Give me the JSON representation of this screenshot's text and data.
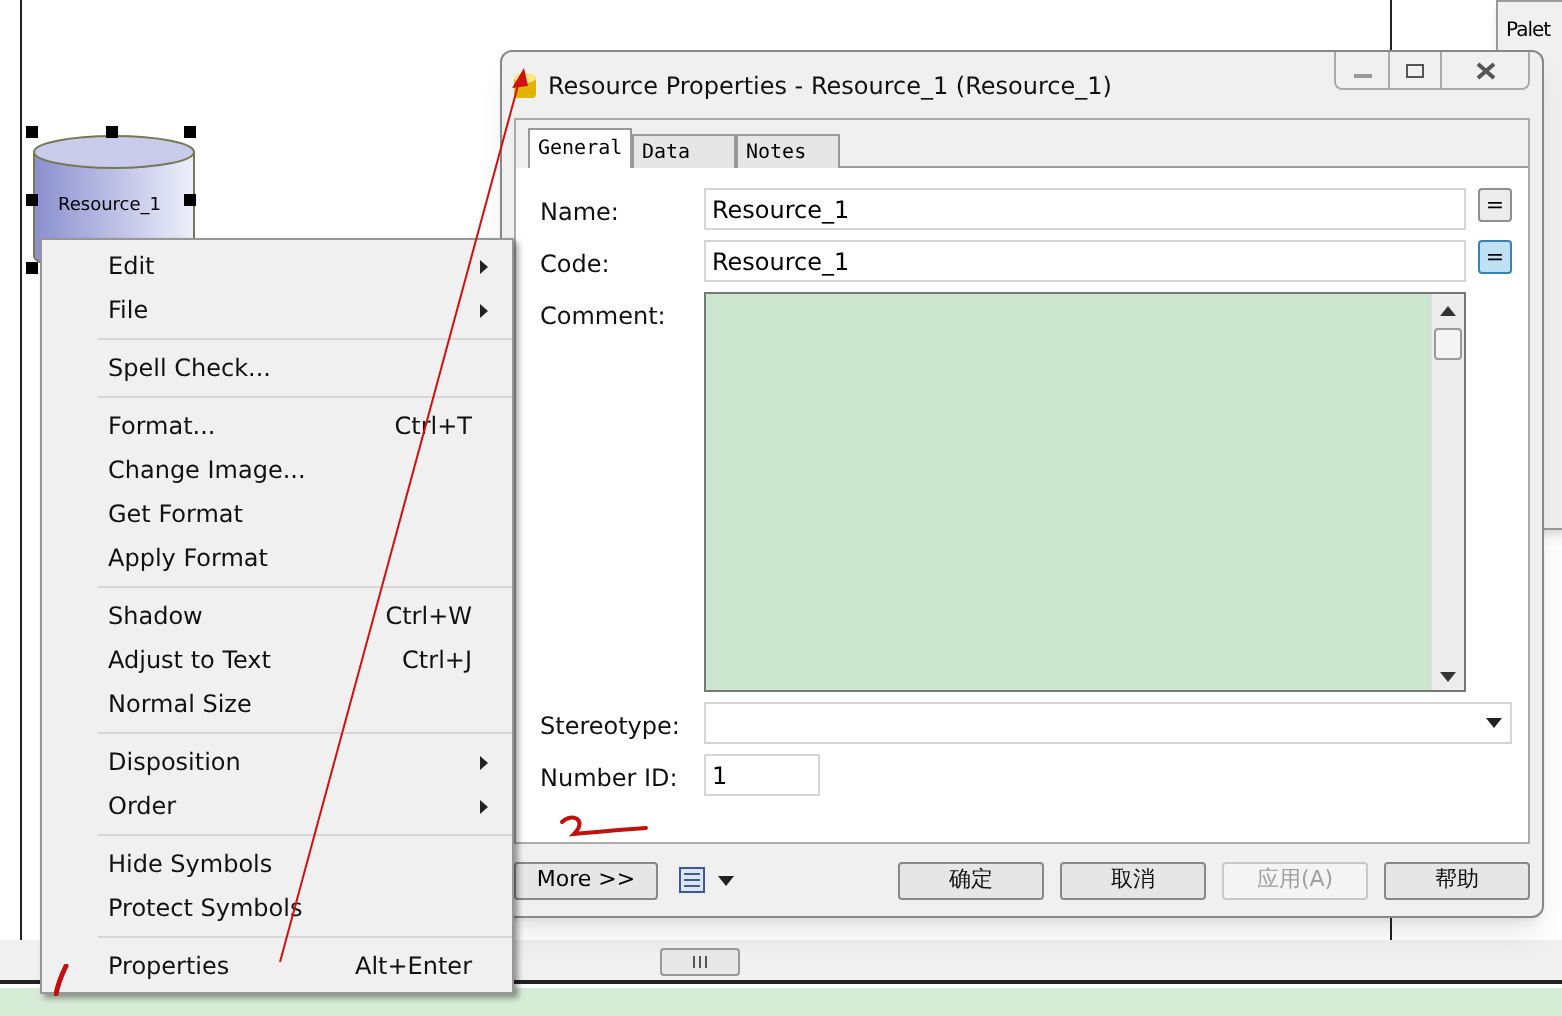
{
  "diagram": {
    "symbol": {
      "label": "Resource_1",
      "selected": true
    }
  },
  "palette_window": {
    "title": "Palet"
  },
  "dialog": {
    "title": "Resource Properties - Resource_1 (Resource_1)",
    "tabs": [
      {
        "label": "General",
        "selected": true
      },
      {
        "label": "Data",
        "selected": false
      },
      {
        "label": "Notes",
        "selected": false
      }
    ],
    "fields": [
      {
        "kind": "text",
        "label": "Name:",
        "value": "Resource_1",
        "button": "=",
        "focused": false
      },
      {
        "kind": "text",
        "label": "Code:",
        "value": "Resource_1",
        "button": "=",
        "focused": true
      },
      {
        "kind": "memo",
        "label": "Comment:"
      },
      {
        "kind": "combo",
        "label": "Stereotype:"
      },
      {
        "kind": "short",
        "label": "Number ID:",
        "value": "1"
      }
    ],
    "more_button": "More >>",
    "buttons": [
      {
        "label": "确定",
        "disabled": false
      },
      {
        "label": "取消",
        "disabled": false
      },
      {
        "label": "应用(A)",
        "disabled": true
      },
      {
        "label": "帮助",
        "disabled": false
      }
    ]
  },
  "context_menu": {
    "groups": [
      [
        {
          "label": "Edit",
          "submenu": true
        },
        {
          "label": "File",
          "submenu": true
        }
      ],
      [
        {
          "label": "Spell Check..."
        }
      ],
      [
        {
          "label": "Format...",
          "shortcut": "Ctrl+T"
        },
        {
          "label": "Change Image..."
        },
        {
          "label": "Get Format"
        },
        {
          "label": "Apply Format"
        }
      ],
      [
        {
          "label": "Shadow",
          "shortcut": "Ctrl+W"
        },
        {
          "label": "Adjust to Text",
          "shortcut": "Ctrl+J"
        },
        {
          "label": "Normal Size"
        }
      ],
      [
        {
          "label": "Disposition",
          "submenu": true
        },
        {
          "label": "Order",
          "submenu": true
        }
      ],
      [
        {
          "label": "Hide Symbols"
        },
        {
          "label": "Protect Symbols"
        }
      ],
      [
        {
          "label": "Properties",
          "shortcut": "Alt+Enter"
        }
      ]
    ]
  }
}
